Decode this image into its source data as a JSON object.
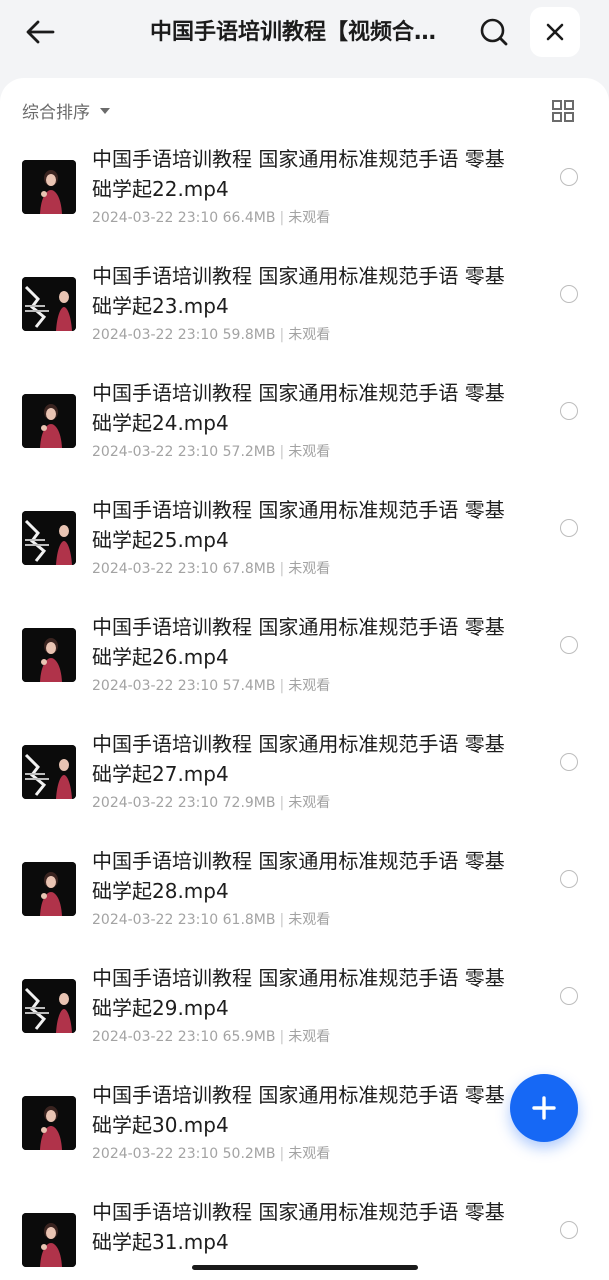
{
  "header": {
    "title": "中国手语培训教程【视频合集】",
    "back_icon": "arrow-left-icon",
    "search_icon": "search-icon",
    "close_icon": "close-icon"
  },
  "toolbar": {
    "sort_label": "综合排序",
    "sort_icon": "caret-down-icon",
    "view_icon": "grid-view-icon"
  },
  "files": [
    {
      "name": "中国手语培训教程 国家通用标准规范手语 零基础学起22.mp4",
      "date": "2024-03-22 23:10",
      "size": "66.4MB",
      "status": "未观看",
      "thumb": "woman-signer"
    },
    {
      "name": "中国手语培训教程 国家通用标准规范手语 零基础学起23.mp4",
      "date": "2024-03-22 23:10",
      "size": "59.8MB",
      "status": "未观看",
      "thumb": "title-card"
    },
    {
      "name": "中国手语培训教程 国家通用标准规范手语 零基础学起24.mp4",
      "date": "2024-03-22 23:10",
      "size": "57.2MB",
      "status": "未观看",
      "thumb": "woman-signer"
    },
    {
      "name": "中国手语培训教程 国家通用标准规范手语 零基础学起25.mp4",
      "date": "2024-03-22 23:10",
      "size": "67.8MB",
      "status": "未观看",
      "thumb": "title-card"
    },
    {
      "name": "中国手语培训教程 国家通用标准规范手语 零基础学起26.mp4",
      "date": "2024-03-22 23:10",
      "size": "57.4MB",
      "status": "未观看",
      "thumb": "woman-signer"
    },
    {
      "name": "中国手语培训教程 国家通用标准规范手语 零基础学起27.mp4",
      "date": "2024-03-22 23:10",
      "size": "72.9MB",
      "status": "未观看",
      "thumb": "title-card"
    },
    {
      "name": "中国手语培训教程 国家通用标准规范手语 零基础学起28.mp4",
      "date": "2024-03-22 23:10",
      "size": "61.8MB",
      "status": "未观看",
      "thumb": "woman-signer"
    },
    {
      "name": "中国手语培训教程 国家通用标准规范手语 零基础学起29.mp4",
      "date": "2024-03-22 23:10",
      "size": "65.9MB",
      "status": "未观看",
      "thumb": "title-card"
    },
    {
      "name": "中国手语培训教程 国家通用标准规范手语 零基础学起30.mp4",
      "date": "2024-03-22 23:10",
      "size": "50.2MB",
      "status": "未观看",
      "thumb": "woman-signer"
    },
    {
      "name": "中国手语培训教程 国家通用标准规范手语 零基础学起31.mp4",
      "date": "",
      "size": "",
      "status": "",
      "thumb": "woman-signer"
    }
  ],
  "fab": {
    "icon": "plus-icon"
  },
  "colors": {
    "accent": "#1668f5",
    "header_bg": "#f3f4f6",
    "meta_text": "#a3a3a3"
  }
}
